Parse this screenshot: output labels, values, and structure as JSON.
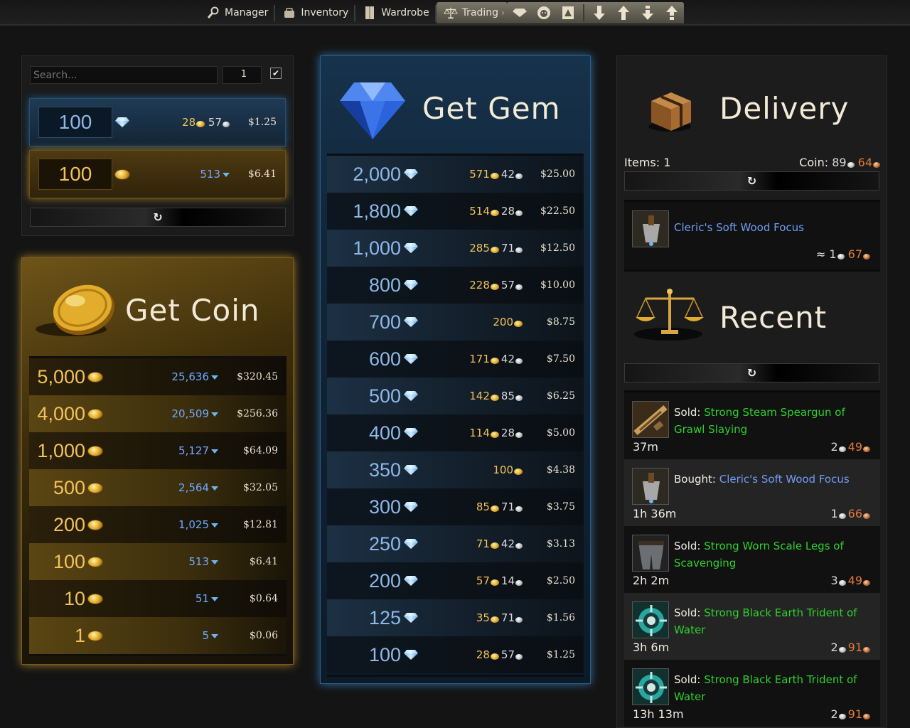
{
  "nav": {
    "tabs": [
      {
        "label": "Manager",
        "icon": "magnifier-icon"
      },
      {
        "label": "Inventory",
        "icon": "bag-icon"
      },
      {
        "label": "Wardrobe",
        "icon": "wardrobe-icon"
      },
      {
        "label": "Trading",
        "icon": "scales-icon"
      }
    ],
    "trail_icons": [
      "gem-icon",
      "lion-icon",
      "sell-listing-icon",
      "down-arrow-icon",
      "up-arrow-icon",
      "collect-down-icon",
      "collect-up-icon"
    ]
  },
  "exchange": {
    "search_placeholder": "Search...",
    "quantity": "1",
    "checkbox_checked": true,
    "gem_row": {
      "amount": "100",
      "gold": "28",
      "silver": "57",
      "price": "$1.25"
    },
    "coin_row": {
      "amount": "100",
      "gems": "513",
      "price": "$6.41"
    }
  },
  "get_coin": {
    "title": "Get Coin",
    "rows": [
      {
        "amount": "5,000",
        "gems": "25,636",
        "price": "$320.45"
      },
      {
        "amount": "4,000",
        "gems": "20,509",
        "price": "$256.36"
      },
      {
        "amount": "1,000",
        "gems": "5,127",
        "price": "$64.09"
      },
      {
        "amount": "500",
        "gems": "2,564",
        "price": "$32.05"
      },
      {
        "amount": "200",
        "gems": "1,025",
        "price": "$12.81"
      },
      {
        "amount": "100",
        "gems": "513",
        "price": "$6.41"
      },
      {
        "amount": "10",
        "gems": "51",
        "price": "$0.64"
      },
      {
        "amount": "1",
        "gems": "5",
        "price": "$0.06"
      }
    ]
  },
  "get_gem": {
    "title": "Get Gem",
    "rows": [
      {
        "amount": "2,000",
        "gold": "571",
        "silver": "42",
        "price": "$25.00"
      },
      {
        "amount": "1,800",
        "gold": "514",
        "silver": "28",
        "price": "$22.50"
      },
      {
        "amount": "1,000",
        "gold": "285",
        "silver": "71",
        "price": "$12.50"
      },
      {
        "amount": "800",
        "gold": "228",
        "silver": "57",
        "price": "$10.00"
      },
      {
        "amount": "700",
        "gold": "200",
        "silver": "",
        "price": "$8.75"
      },
      {
        "amount": "600",
        "gold": "171",
        "silver": "42",
        "price": "$7.50"
      },
      {
        "amount": "500",
        "gold": "142",
        "silver": "85",
        "price": "$6.25"
      },
      {
        "amount": "400",
        "gold": "114",
        "silver": "28",
        "price": "$5.00"
      },
      {
        "amount": "350",
        "gold": "100",
        "silver": "",
        "price": "$4.38"
      },
      {
        "amount": "300",
        "gold": "85",
        "silver": "71",
        "price": "$3.75"
      },
      {
        "amount": "250",
        "gold": "71",
        "silver": "42",
        "price": "$3.13"
      },
      {
        "amount": "200",
        "gold": "57",
        "silver": "14",
        "price": "$2.50"
      },
      {
        "amount": "125",
        "gold": "35",
        "silver": "71",
        "price": "$1.56"
      },
      {
        "amount": "100",
        "gold": "28",
        "silver": "57",
        "price": "$1.25"
      }
    ]
  },
  "delivery": {
    "title": "Delivery",
    "items_label": "Items: 1",
    "coin_label": "Coin:",
    "coin_silver": "89",
    "coin_copper": "64",
    "item": {
      "name": "Cleric's Soft Wood Focus",
      "approx": "≈",
      "silver": "1",
      "copper": "67"
    }
  },
  "recent": {
    "title": "Recent",
    "rows": [
      {
        "action": "Sold",
        "item": "Strong Steam Speargun of Grawl Slaying",
        "rarity": "green",
        "time": "37m",
        "silver": "2",
        "copper": "49",
        "icon": "speargun-icon"
      },
      {
        "action": "Bought",
        "item": "Cleric's Soft Wood Focus",
        "rarity": "blue",
        "time": "1h 36m",
        "silver": "1",
        "copper": "66",
        "icon": "focus-icon"
      },
      {
        "action": "Sold",
        "item": "Strong Worn Scale Legs of Scavenging",
        "rarity": "green",
        "time": "2h 2m",
        "silver": "3",
        "copper": "49",
        "icon": "legs-armor-icon"
      },
      {
        "action": "Sold",
        "item": "Strong Black Earth Trident of Water",
        "rarity": "green",
        "time": "3h 6m",
        "silver": "2",
        "copper": "91",
        "icon": "trident-icon"
      },
      {
        "action": "Sold",
        "item": "Strong Black Earth Trident of Water",
        "rarity": "green",
        "time": "13h 13m",
        "silver": "2",
        "copper": "91",
        "icon": "trident-icon"
      }
    ]
  },
  "refresh_glyph": "↻",
  "colors": {
    "gold": "#f2c25a",
    "gem_blue": "#6fa9ff",
    "green_rarity": "#2fcf2f",
    "blue_rarity": "#6f9cf5",
    "copper": "#e07a3c"
  }
}
